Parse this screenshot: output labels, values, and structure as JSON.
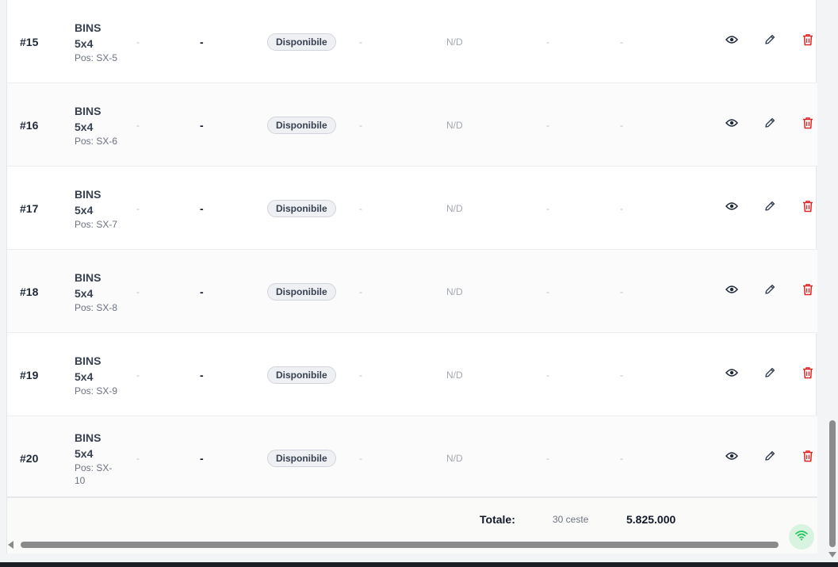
{
  "rows": [
    {
      "id": "#15",
      "name": "BINS 5x4",
      "pos": "Pos: SX-5",
      "col_a": "-",
      "col_b": "-",
      "status": "Disponibile",
      "col_c": "-",
      "nd": "N/D",
      "col_d": "-",
      "col_e": "-"
    },
    {
      "id": "#16",
      "name": "BINS 5x4",
      "pos": "Pos: SX-6",
      "col_a": "-",
      "col_b": "-",
      "status": "Disponibile",
      "col_c": "-",
      "nd": "N/D",
      "col_d": "-",
      "col_e": "-"
    },
    {
      "id": "#17",
      "name": "BINS 5x4",
      "pos": "Pos: SX-7",
      "col_a": "-",
      "col_b": "-",
      "status": "Disponibile",
      "col_c": "-",
      "nd": "N/D",
      "col_d": "-",
      "col_e": "-"
    },
    {
      "id": "#18",
      "name": "BINS 5x4",
      "pos": "Pos: SX-8",
      "col_a": "-",
      "col_b": "-",
      "status": "Disponibile",
      "col_c": "-",
      "nd": "N/D",
      "col_d": "-",
      "col_e": "-"
    },
    {
      "id": "#19",
      "name": "BINS 5x4",
      "pos": "Pos: SX-9",
      "col_a": "-",
      "col_b": "-",
      "status": "Disponibile",
      "col_c": "-",
      "nd": "N/D",
      "col_d": "-",
      "col_e": "-"
    },
    {
      "id": "#20",
      "name": "BINS 5x4",
      "pos": "Pos: SX-10",
      "col_a": "-",
      "col_b": "-",
      "status": "Disponibile",
      "col_c": "-",
      "nd": "N/D",
      "col_d": "-",
      "col_e": "-"
    }
  ],
  "actions": {
    "view_icon": "eye-icon",
    "edit_icon": "pencil-icon",
    "delete_icon": "trash-icon"
  },
  "footer": {
    "label": "Totale:",
    "count": "30 ceste",
    "total": "5.825.000"
  },
  "status_widget": {
    "icon": "wifi-icon",
    "color": "#22c55e"
  },
  "colors": {
    "delete": "#dc2626",
    "badge_bg": "#eef0f3",
    "muted": "#6b7280"
  }
}
